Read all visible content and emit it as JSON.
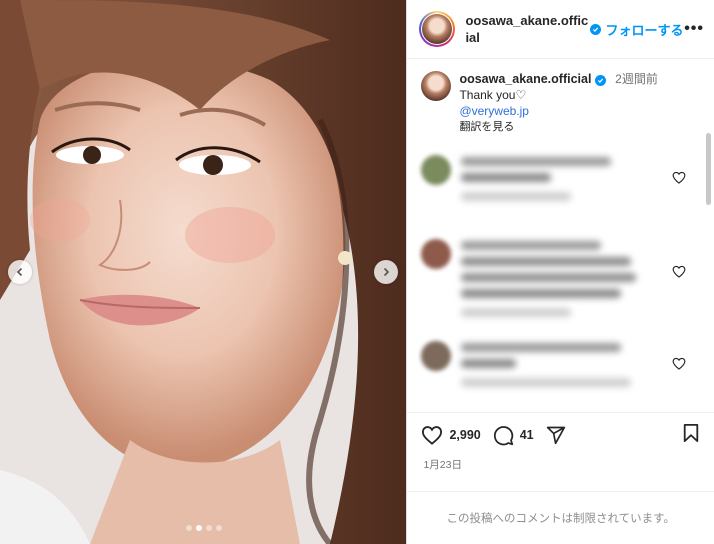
{
  "post": {
    "username": "oosawa_akane.official",
    "follow_label": "フォローする",
    "more_label": "•••"
  },
  "caption": {
    "username": "oosawa_akane.official",
    "time": "2週間前",
    "text": "Thank you♡",
    "mention": "@veryweb.jp",
    "translate": "翻訳を見る"
  },
  "actions": {
    "likes": "2,990",
    "comments": "41"
  },
  "date": "1月23日",
  "restricted_notice": "この投稿へのコメントは制限されています。",
  "carousel": {
    "total": 4,
    "active": 2
  },
  "colors": {
    "accent": "#0095f6",
    "verified": "#0095f6",
    "muted": "#737373"
  }
}
